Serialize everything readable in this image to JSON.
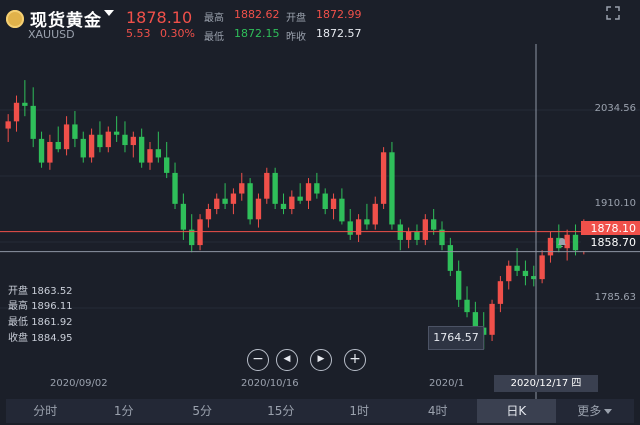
{
  "header": {
    "title": "现货黄金",
    "symbol": "XAUUSD",
    "price": "1878.10",
    "change": "5.53",
    "change_pct": "0.30%",
    "high_label": "最高",
    "high": "1882.62",
    "low_label": "最低",
    "low": "1872.15",
    "open_label": "开盘",
    "open": "1872.99",
    "prev_close_label": "昨收",
    "prev_close": "1872.57"
  },
  "ohlc_panel": {
    "open_label": "开盘",
    "open": "1863.52",
    "high_label": "最高",
    "high": "1896.11",
    "low_label": "最低",
    "low": "1861.92",
    "close_label": "收盘",
    "close": "1884.95"
  },
  "axis": {
    "right_ticks": [
      "2034.56",
      "1910.10",
      "1785.63"
    ],
    "date_ticks": [
      "2020/09/02",
      "2020/10/16",
      "2020/1"
    ],
    "highlight_date": "2020/12/17 四",
    "current_price_tag": "1878.10",
    "cursor_price_tag": "1858.70"
  },
  "tooltip": {
    "value": "1764.57"
  },
  "controls": {
    "zoom_out": "−",
    "prev": "◀",
    "next": "▶",
    "zoom_in": "+"
  },
  "tabs": [
    "分时",
    "1分",
    "5分",
    "15分",
    "1时",
    "4时",
    "日K",
    "更多"
  ],
  "active_tab": "日K",
  "colors": {
    "up": "#f0504a",
    "down": "#2fbf5a",
    "bg": "#1b1f29"
  },
  "chart_data": {
    "type": "candlestick",
    "x": [
      "2020/09/02",
      "2020/10/16",
      "2020/12/17"
    ],
    "candles": [
      [
        1978,
        1992,
        1965,
        1985
      ],
      [
        1985,
        2010,
        1975,
        2003
      ],
      [
        2003,
        2025,
        1990,
        2000
      ],
      [
        2000,
        2018,
        1960,
        1968
      ],
      [
        1968,
        1975,
        1940,
        1945
      ],
      [
        1945,
        1972,
        1938,
        1965
      ],
      [
        1965,
        1980,
        1955,
        1958
      ],
      [
        1958,
        1990,
        1952,
        1982
      ],
      [
        1982,
        1995,
        1960,
        1968
      ],
      [
        1968,
        1975,
        1945,
        1950
      ],
      [
        1950,
        1978,
        1945,
        1972
      ],
      [
        1972,
        1985,
        1955,
        1960
      ],
      [
        1960,
        1980,
        1955,
        1975
      ],
      [
        1975,
        1990,
        1965,
        1972
      ],
      [
        1972,
        1985,
        1955,
        1962
      ],
      [
        1962,
        1975,
        1950,
        1970
      ],
      [
        1970,
        1978,
        1940,
        1945
      ],
      [
        1945,
        1965,
        1938,
        1958
      ],
      [
        1958,
        1975,
        1945,
        1950
      ],
      [
        1950,
        1965,
        1930,
        1935
      ],
      [
        1935,
        1945,
        1900,
        1905
      ],
      [
        1905,
        1915,
        1870,
        1880
      ],
      [
        1880,
        1895,
        1858,
        1865
      ],
      [
        1865,
        1895,
        1860,
        1890
      ],
      [
        1890,
        1905,
        1882,
        1900
      ],
      [
        1900,
        1915,
        1895,
        1910
      ],
      [
        1910,
        1925,
        1900,
        1905
      ],
      [
        1905,
        1920,
        1895,
        1915
      ],
      [
        1915,
        1935,
        1908,
        1925
      ],
      [
        1925,
        1930,
        1885,
        1890
      ],
      [
        1890,
        1915,
        1882,
        1910
      ],
      [
        1910,
        1940,
        1905,
        1935
      ],
      [
        1935,
        1940,
        1900,
        1905
      ],
      [
        1905,
        1915,
        1895,
        1900
      ],
      [
        1900,
        1918,
        1895,
        1912
      ],
      [
        1912,
        1925,
        1905,
        1908
      ],
      [
        1908,
        1930,
        1900,
        1925
      ],
      [
        1925,
        1935,
        1910,
        1915
      ],
      [
        1915,
        1920,
        1895,
        1900
      ],
      [
        1900,
        1915,
        1890,
        1910
      ],
      [
        1910,
        1920,
        1885,
        1888
      ],
      [
        1888,
        1900,
        1870,
        1875
      ],
      [
        1875,
        1895,
        1868,
        1890
      ],
      [
        1890,
        1905,
        1880,
        1885
      ],
      [
        1885,
        1912,
        1880,
        1905
      ],
      [
        1905,
        1960,
        1900,
        1955
      ],
      [
        1955,
        1965,
        1880,
        1885
      ],
      [
        1885,
        1890,
        1860,
        1870
      ],
      [
        1870,
        1882,
        1862,
        1878
      ],
      [
        1878,
        1885,
        1865,
        1870
      ],
      [
        1870,
        1895,
        1865,
        1890
      ],
      [
        1890,
        1900,
        1875,
        1880
      ],
      [
        1880,
        1888,
        1860,
        1865
      ],
      [
        1865,
        1872,
        1835,
        1840
      ],
      [
        1840,
        1850,
        1805,
        1812
      ],
      [
        1812,
        1825,
        1795,
        1800
      ],
      [
        1800,
        1810,
        1778,
        1785
      ],
      [
        1785,
        1800,
        1764,
        1778
      ],
      [
        1778,
        1812,
        1772,
        1808
      ],
      [
        1808,
        1835,
        1800,
        1830
      ],
      [
        1830,
        1850,
        1822,
        1845
      ],
      [
        1845,
        1862,
        1835,
        1840
      ],
      [
        1840,
        1850,
        1826,
        1835
      ],
      [
        1835,
        1845,
        1825,
        1832
      ],
      [
        1832,
        1860,
        1828,
        1855
      ],
      [
        1855,
        1878,
        1848,
        1872
      ],
      [
        1872,
        1885,
        1858,
        1862
      ],
      [
        1862,
        1880,
        1850,
        1875
      ],
      [
        1875,
        1885,
        1855,
        1860
      ],
      [
        1860,
        1890,
        1856,
        1878
      ]
    ],
    "ylim": [
      1740,
      2060
    ],
    "grid": true
  }
}
